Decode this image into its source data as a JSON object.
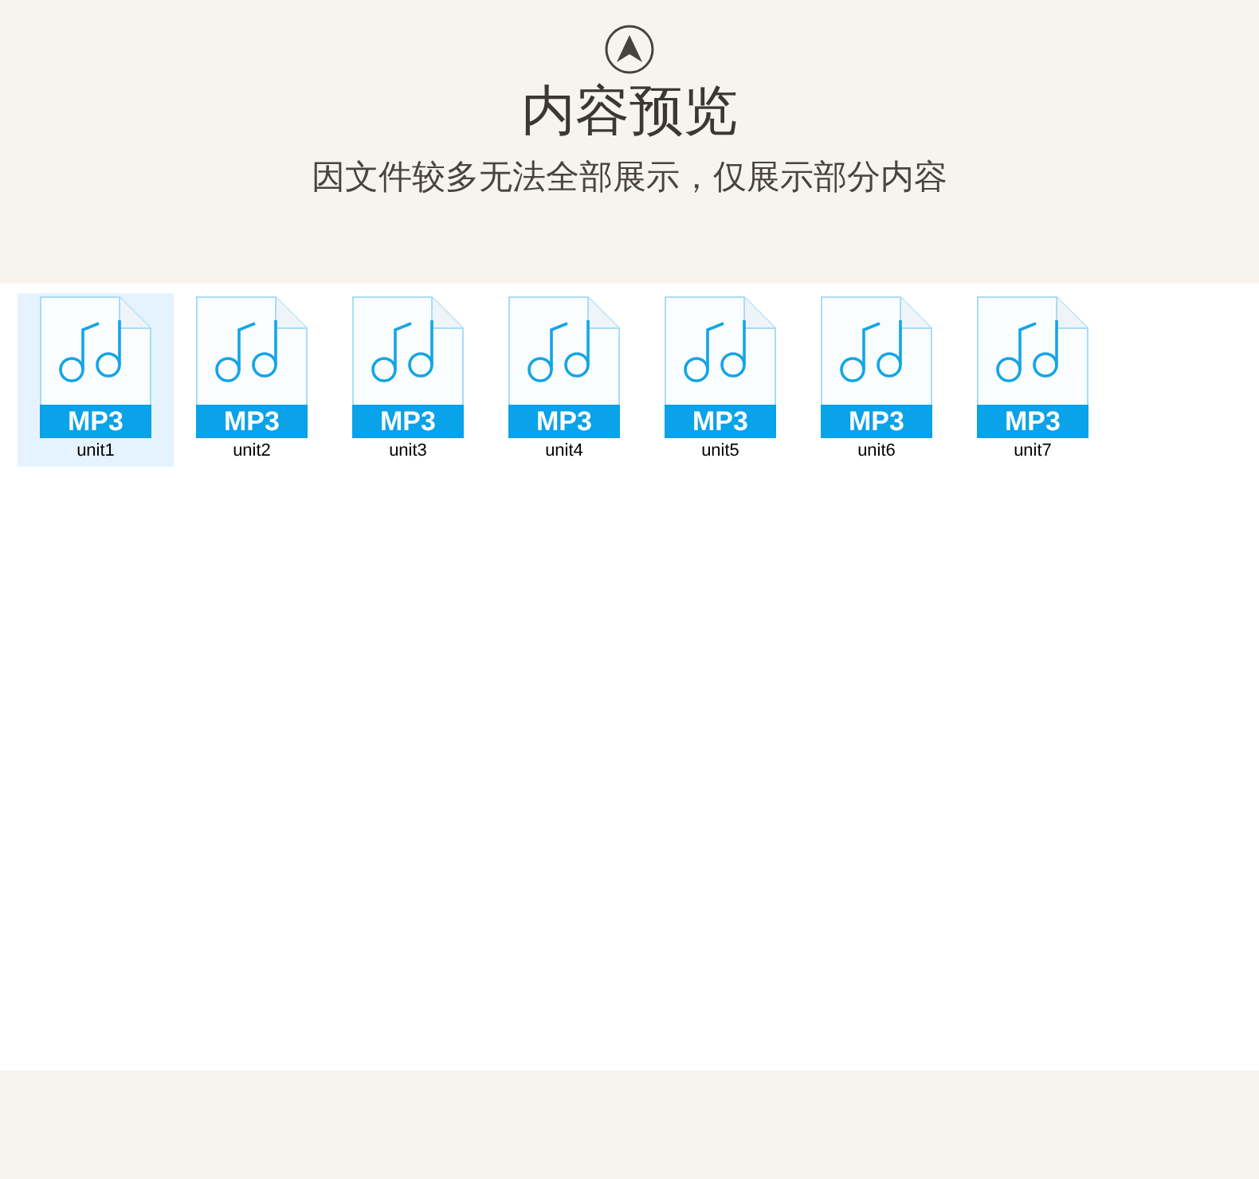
{
  "header": {
    "title": "内容预览",
    "subtitle": "因文件较多无法全部展示，仅展示部分内容"
  },
  "files": [
    {
      "name": "unit1",
      "badge": "MP3",
      "selected": true
    },
    {
      "name": "unit2",
      "badge": "MP3",
      "selected": false
    },
    {
      "name": "unit3",
      "badge": "MP3",
      "selected": false
    },
    {
      "name": "unit4",
      "badge": "MP3",
      "selected": false
    },
    {
      "name": "unit5",
      "badge": "MP3",
      "selected": false
    },
    {
      "name": "unit6",
      "badge": "MP3",
      "selected": false
    },
    {
      "name": "unit7",
      "badge": "MP3",
      "selected": false
    }
  ]
}
